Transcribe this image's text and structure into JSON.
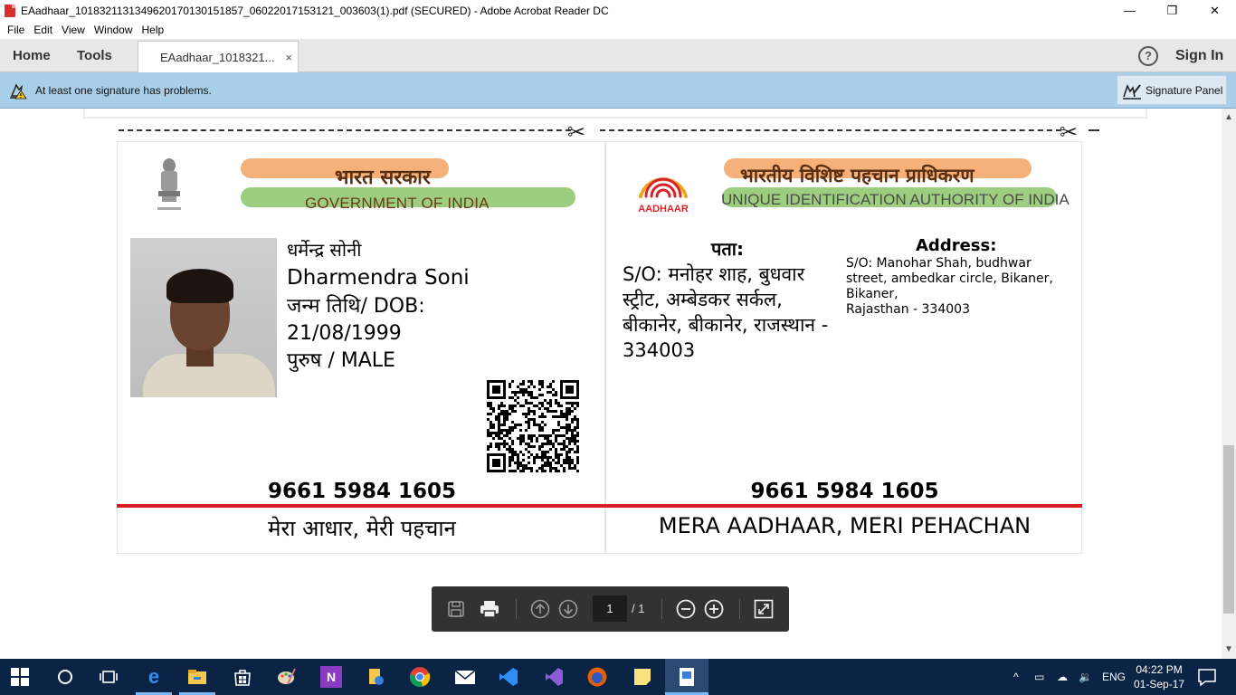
{
  "window": {
    "title": "EAadhaar_1018321131349620170130151857_06022017153121_003603(1).pdf (SECURED) - Adobe Acrobat Reader DC",
    "minimize": "—",
    "restore": "❐",
    "close": "✕"
  },
  "menu": {
    "items": [
      "File",
      "Edit",
      "View",
      "Window",
      "Help"
    ]
  },
  "tabs": {
    "home": "Home",
    "tools": "Tools",
    "document": "EAadhaar_1018321...",
    "close": "×",
    "help": "?",
    "sign_in": "Sign In"
  },
  "signature_bar": {
    "message": "At least one signature has problems.",
    "panel_button": "Signature Panel"
  },
  "card_front": {
    "gov_hindi": "भारत सरकार",
    "gov_english": "GOVERNMENT OF INDIA",
    "name_hindi": "धर्मेन्द्र सोनी",
    "name_english": "Dharmendra Soni",
    "dob_label": "जन्म तिथि/ DOB:",
    "dob": "21/08/1999",
    "gender": "पुरुष  / MALE",
    "aadhaar_number": "9661 5984 1605",
    "tagline": "मेरा आधार, मेरी पहचान"
  },
  "card_back": {
    "logo_text": "AADHAAR",
    "uidai_hindi": "भारतीय विशिष्ट पहचान प्राधिकरण",
    "uidai_english": "UNIQUE IDENTIFICATION AUTHORITY OF INDIA",
    "address_label_hindi": "पता:",
    "address_hindi": "S/O: मनोहर शाह, बुधवार स्ट्रीट, अम्बेडकर सर्कल, बीकानेर, बीकानेर, राजस्थान - 334003",
    "address_label_english": "Address:",
    "address_english": "S/O: Manohar Shah, budhwar street, ambedkar circle, Bikaner, Bikaner,",
    "address_english_2": "Rajasthan - 334003",
    "aadhaar_number": "9661 5984 1605",
    "tagline": "MERA AADHAAR, MERI PEHACHAN"
  },
  "page_toolbar": {
    "current_page": "1",
    "total_pages": "/ 1"
  },
  "taskbar": {
    "language": "ENG",
    "time": "04:22 PM",
    "date": "01-Sep-17"
  },
  "colors": {
    "signature_bar": "#a9cfe8",
    "accent_red": "#d91e1e",
    "taskbar": "#0b2345",
    "toolbar": "#323232"
  }
}
